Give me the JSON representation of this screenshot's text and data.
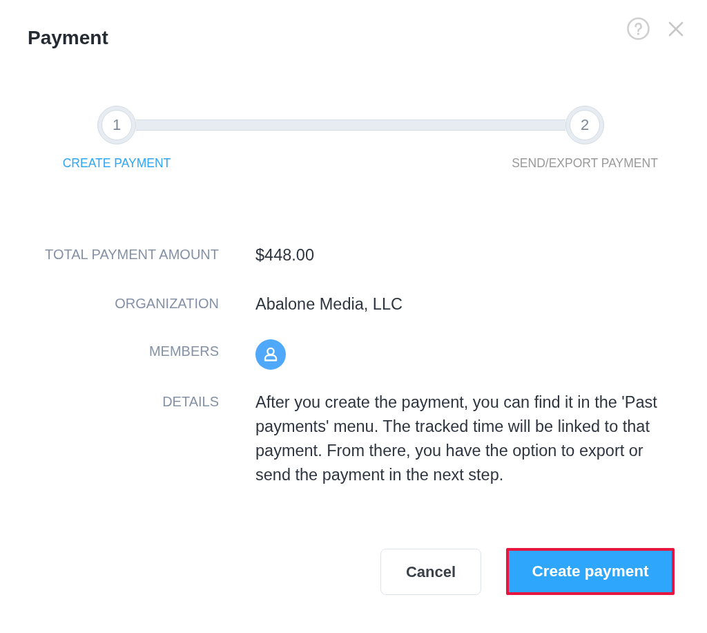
{
  "dialog": {
    "title": "Payment"
  },
  "steps": [
    {
      "number": "1",
      "label": "CREATE PAYMENT",
      "selected": true
    },
    {
      "number": "2",
      "label": "SEND/EXPORT PAYMENT",
      "selected": false
    }
  ],
  "fields": [
    {
      "kind": "text",
      "label": "TOTAL PAYMENT AMOUNT",
      "value": "$448.00"
    },
    {
      "kind": "text",
      "label": "ORGANIZATION",
      "value": "Abalone Media, LLC"
    },
    {
      "kind": "avatar",
      "label": "MEMBERS"
    },
    {
      "kind": "paragraph",
      "label": "DETAILS",
      "value": "After you create the payment, you can find it in the 'Past payments' menu. The tracked time will be linked to that payment. From there, you have the option to export or send the payment in the next step."
    }
  ],
  "buttons": [
    {
      "kind": "secondary",
      "label": "Cancel",
      "highlighted": false
    },
    {
      "kind": "primary",
      "label": "Create payment",
      "highlighted": true
    }
  ]
}
